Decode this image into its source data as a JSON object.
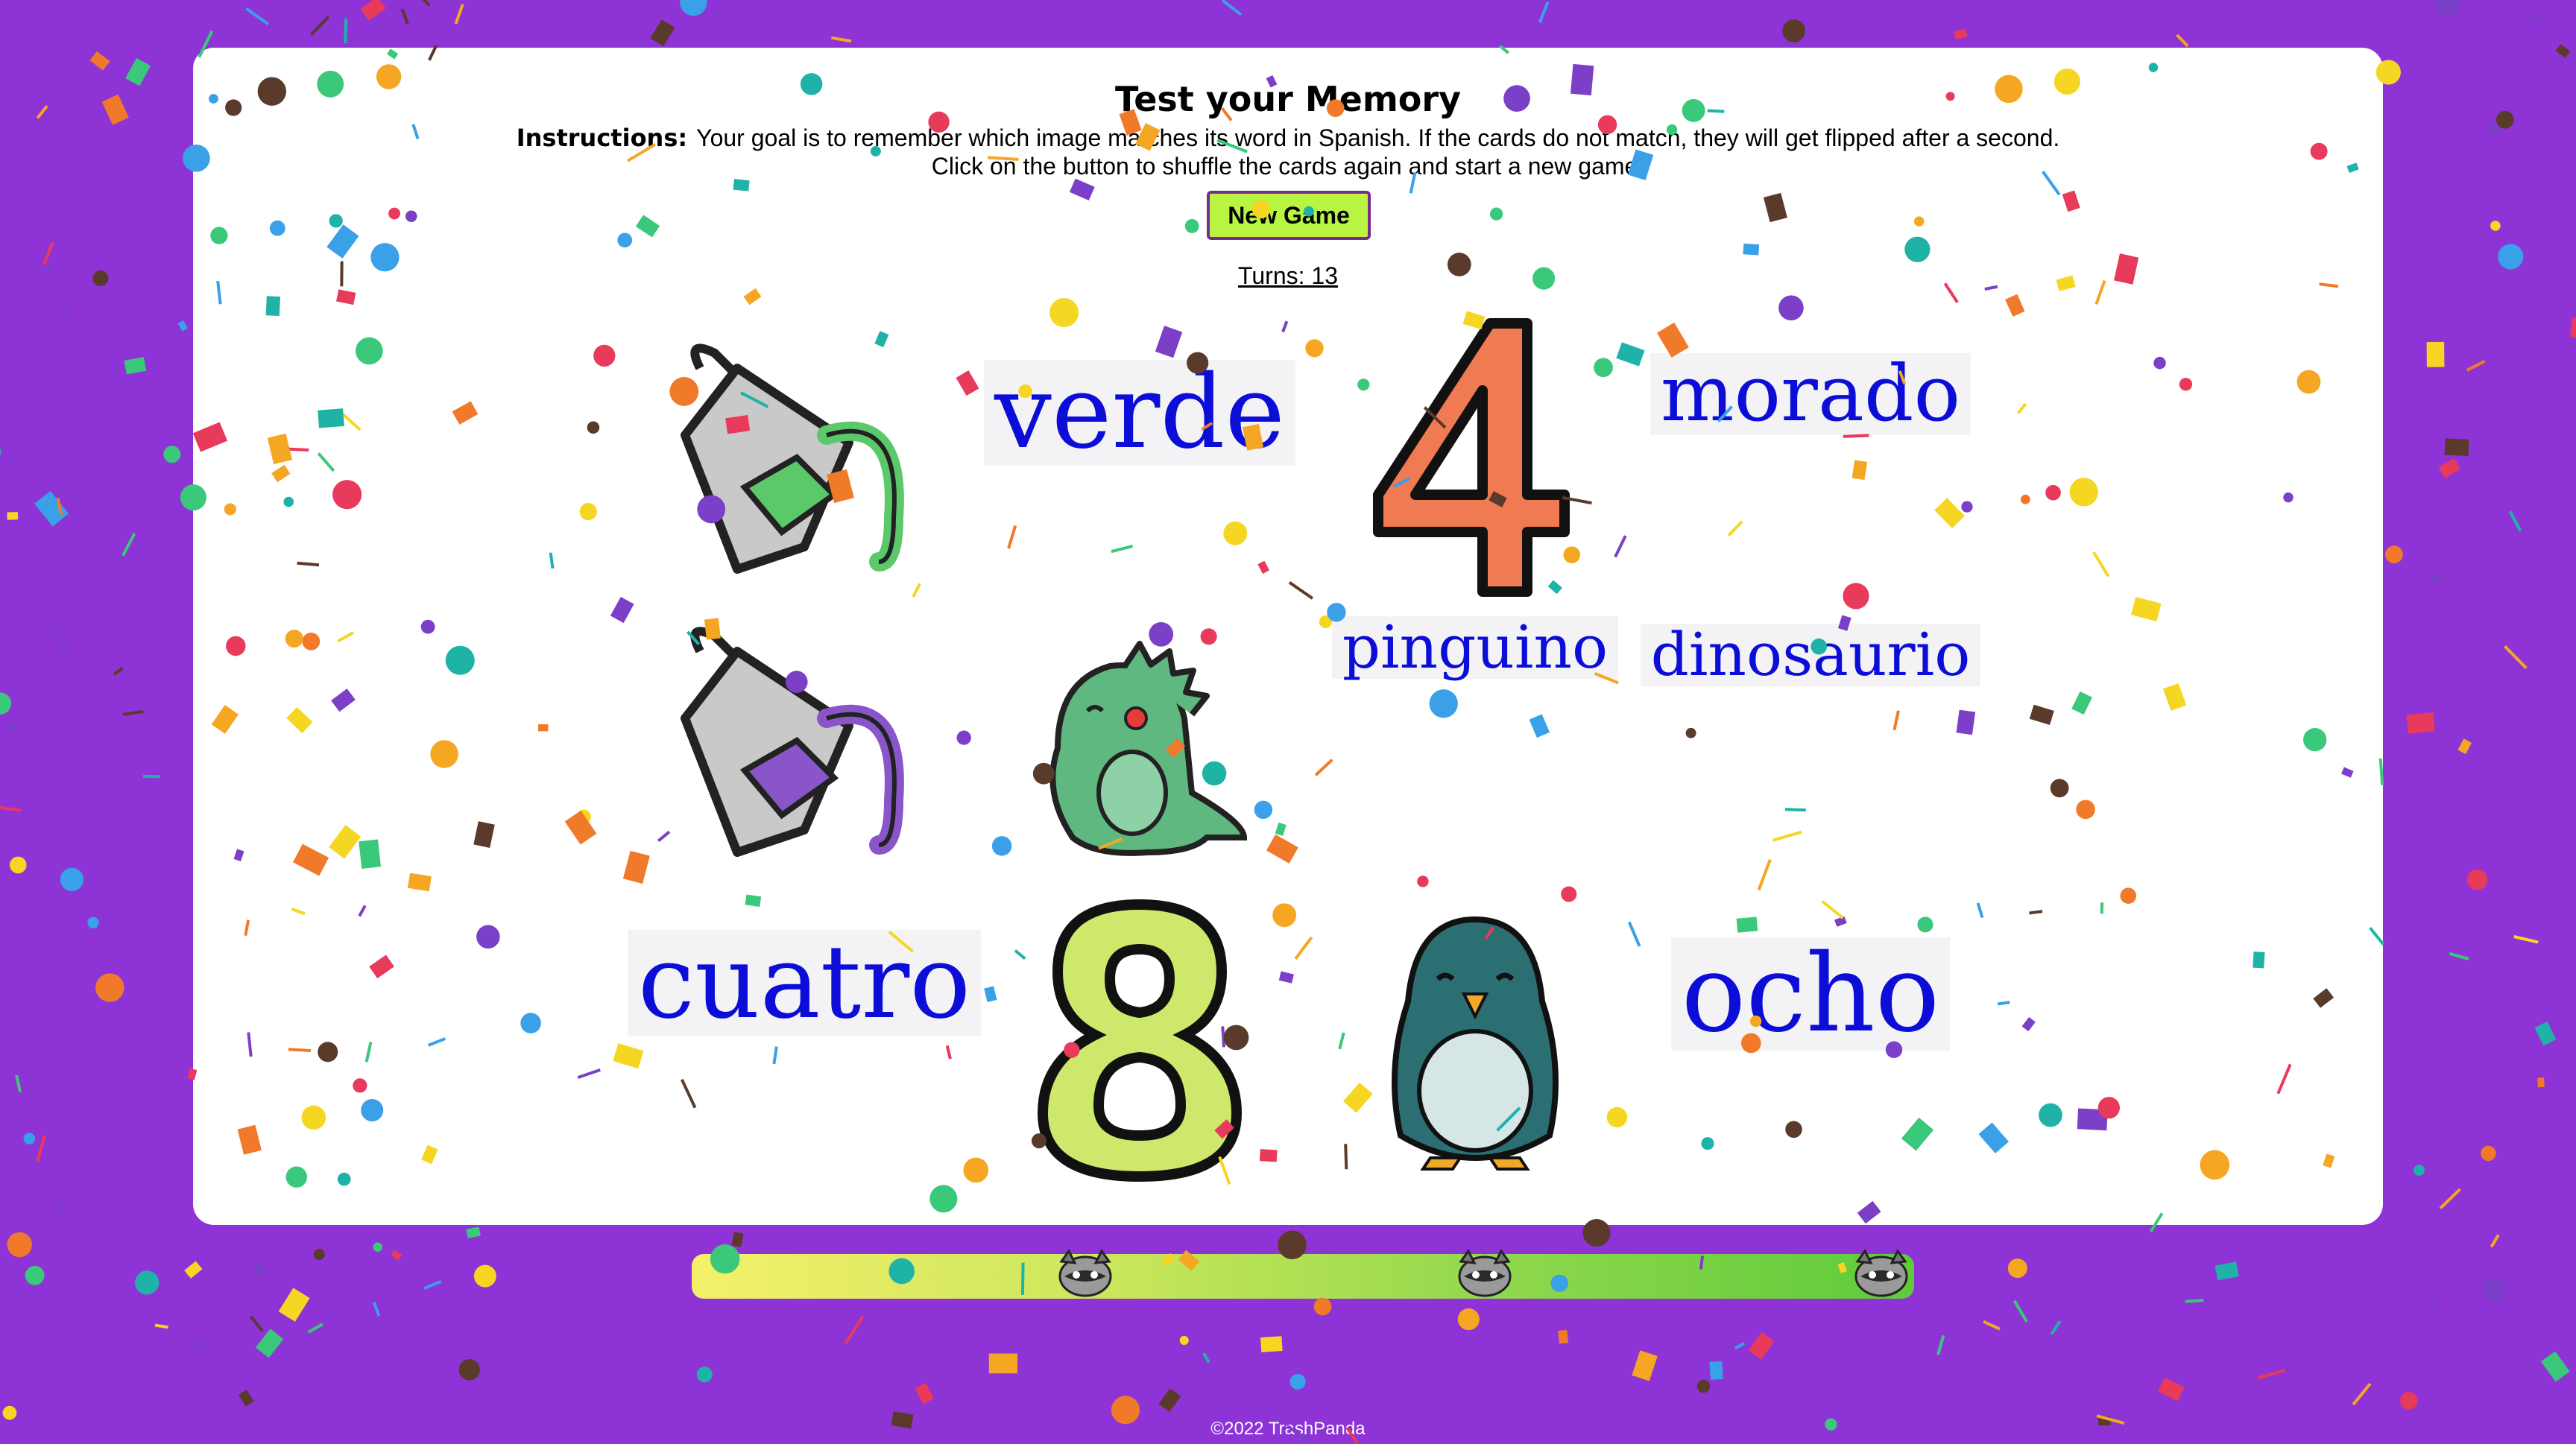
{
  "header": {
    "title": "Test your Memory",
    "instructions_label": "Instructions:",
    "instructions_line1": "Your goal is to remember which image matches its word in Spanish. If the cards do not match, they will get flipped after a second.",
    "instructions_line2": "Click on the button to shuffle the cards again and start a new game."
  },
  "controls": {
    "new_game_label": "New Game"
  },
  "status": {
    "turns": "Turns: 13"
  },
  "cards": {
    "verde": "verde",
    "morado": "morado",
    "pinguino": "pinguino",
    "dinosaurio": "dinosaurio",
    "cuatro": "cuatro",
    "ocho": "ocho"
  },
  "images": {
    "green_paint": "green-paint-bucket-icon",
    "purple_paint": "purple-paint-bucket-icon",
    "dinosaur": "dinosaur-icon",
    "penguin": "penguin-icon",
    "four": "number-four-icon",
    "eight": "number-eight-icon"
  },
  "colors": {
    "background": "#8e33d6",
    "button": "#b8f542",
    "word_text": "#0d0dd8",
    "four": "#f07a52",
    "eight": "#cde86a"
  },
  "progress": {
    "fraction": 1.0
  },
  "footer": {
    "copyright": "©2022 TrashPanda"
  }
}
